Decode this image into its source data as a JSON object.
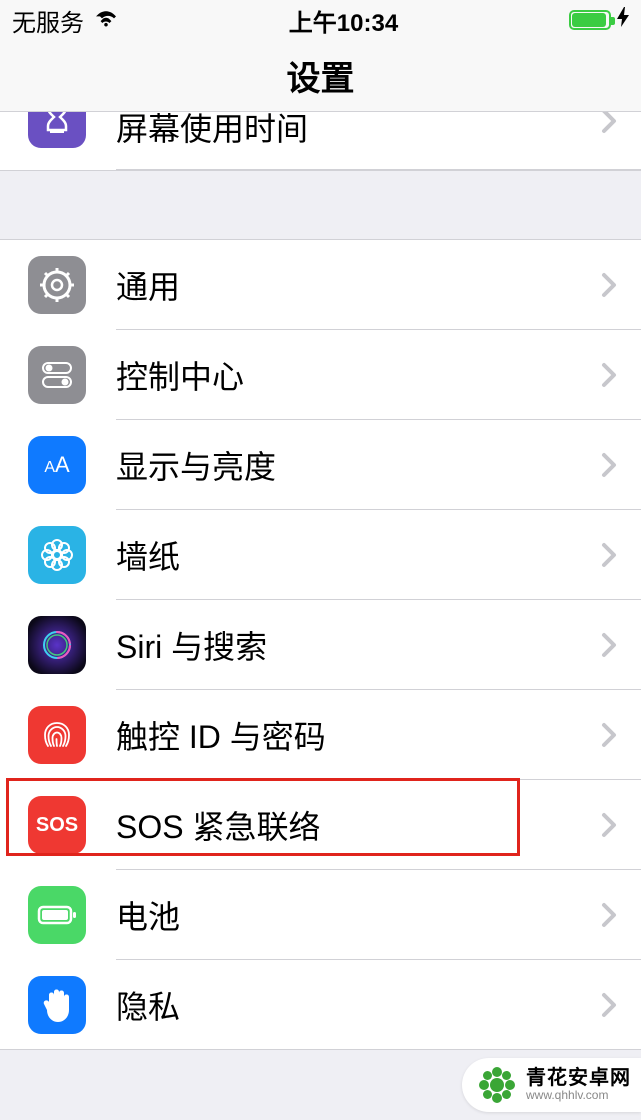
{
  "status": {
    "carrier": "无服务",
    "time": "上午10:34"
  },
  "nav": {
    "title": "设置"
  },
  "partial_row": {
    "label": "屏幕使用时间"
  },
  "section": {
    "items": [
      {
        "label": "通用",
        "icon": "gear",
        "bg": "bg-gray"
      },
      {
        "label": "控制中心",
        "icon": "toggles",
        "bg": "bg-gray"
      },
      {
        "label": "显示与亮度",
        "icon": "aa",
        "bg": "bg-blue"
      },
      {
        "label": "墙纸",
        "icon": "flower",
        "bg": "bg-cyan"
      },
      {
        "label": "Siri 与搜索",
        "icon": "siri",
        "bg": "bg-black"
      },
      {
        "label": "触控 ID 与密码",
        "icon": "fingerprint",
        "bg": "bg-red"
      },
      {
        "label": "SOS 紧急联络",
        "icon": "sos",
        "bg": "bg-sos"
      },
      {
        "label": "电池",
        "icon": "battery",
        "bg": "bg-green"
      },
      {
        "label": "隐私",
        "icon": "hand",
        "bg": "bg-blue"
      }
    ]
  },
  "watermark": {
    "title": "青花安卓网",
    "url": "www.qhhlv.com"
  },
  "icons": {
    "sos_label": "SOS"
  }
}
